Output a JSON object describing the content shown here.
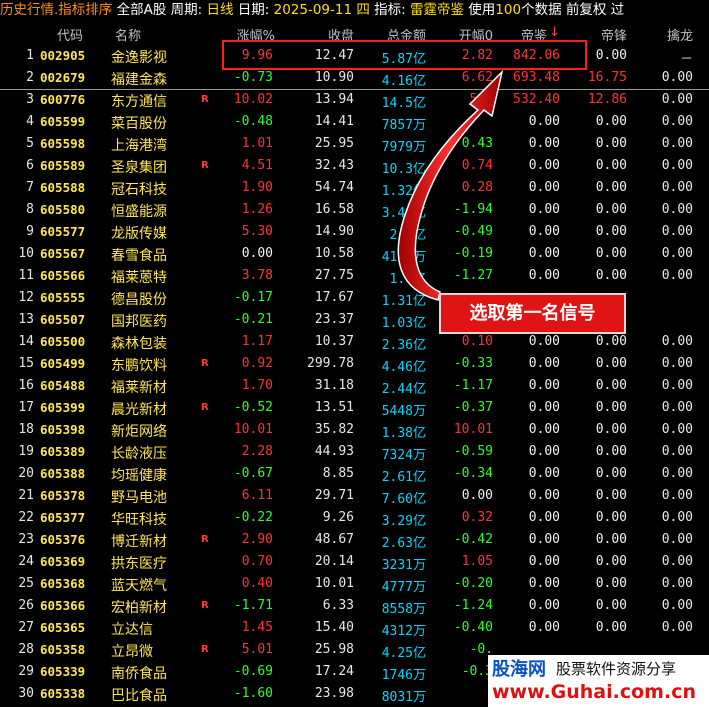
{
  "titlebar": {
    "segments": [
      {
        "text": "历史行情.指标排序 ",
        "color": "orange"
      },
      {
        "text": "全部A股 ",
        "color": "white"
      },
      {
        "text": "周期: ",
        "color": "white"
      },
      {
        "text": "日线 ",
        "color": "yellow"
      },
      {
        "text": "日期: ",
        "color": "white"
      },
      {
        "text": "2025-09-11 四 ",
        "color": "yellow"
      },
      {
        "text": "指标: ",
        "color": "white"
      },
      {
        "text": "雷霆帝鉴 ",
        "color": "yellow"
      },
      {
        "text": "使用",
        "color": "white"
      },
      {
        "text": "100",
        "color": "yellow"
      },
      {
        "text": "个数据 前复权 过",
        "color": "white"
      }
    ]
  },
  "columns": {
    "code": "代码",
    "name": "名称",
    "change": "涨幅%",
    "close": "收盘",
    "amount": "总金额",
    "open": "开幅0",
    "dijian": "帝鉴",
    "sort_arrow": "↓",
    "difeng": "帝锋",
    "qinlong": "擒龙"
  },
  "colors": {
    "up": "#ff3232",
    "down": "#2bff2b",
    "flat": "#f0f0f0",
    "highlight_box": "#ff1e1e",
    "callout_bg": "#e01414"
  },
  "rows": [
    {
      "idx": "1",
      "code": "002905",
      "name": "金逸影视",
      "flag": "",
      "chg": "9.96",
      "chg_dir": "up",
      "close": "12.47",
      "amt": "5.87亿",
      "open": "2.82",
      "open_dir": "up",
      "dj": "842.06",
      "dj_dir": "up",
      "df": "0.00",
      "df_dir": "flat",
      "ql": "－"
    },
    {
      "idx": "2",
      "code": "002679",
      "name": "福建金森",
      "flag": "",
      "chg": "-0.73",
      "chg_dir": "down",
      "close": "10.90",
      "amt": "4.16亿",
      "open": "6.62",
      "open_dir": "up",
      "dj": "693.48",
      "dj_dir": "up",
      "df": "16.75",
      "df_dir": "up",
      "ql": "0.00"
    },
    {
      "idx": "3",
      "code": "600776",
      "name": "东方通信",
      "flag": "R",
      "chg": "10.02",
      "chg_dir": "up",
      "close": "13.94",
      "amt": "14.5亿",
      "open": "5.7",
      "open_dir": "up",
      "dj": "532.40",
      "dj_dir": "up",
      "df": "12.86",
      "df_dir": "up",
      "ql": "0.00"
    },
    {
      "idx": "4",
      "code": "605599",
      "name": "菜百股份",
      "flag": "",
      "chg": "-0.48",
      "chg_dir": "down",
      "close": "14.41",
      "amt": "7857万",
      "open": "",
      "open_dir": "up",
      "dj": "0.00",
      "dj_dir": "flat",
      "df": "0.00",
      "df_dir": "flat",
      "ql": "0.00"
    },
    {
      "idx": "5",
      "code": "605598",
      "name": "上海港湾",
      "flag": "",
      "chg": "1.01",
      "chg_dir": "up",
      "close": "25.95",
      "amt": "7979万",
      "open": "0.43",
      "open_dir": "down",
      "dj": "0.00",
      "dj_dir": "flat",
      "df": "0.00",
      "df_dir": "flat",
      "ql": "0.00"
    },
    {
      "idx": "6",
      "code": "605589",
      "name": "圣泉集团",
      "flag": "R",
      "chg": "4.51",
      "chg_dir": "up",
      "close": "32.43",
      "amt": "10.3亿",
      "open": "0.74",
      "open_dir": "up",
      "dj": "0.00",
      "dj_dir": "flat",
      "df": "0.00",
      "df_dir": "flat",
      "ql": "0.00"
    },
    {
      "idx": "7",
      "code": "605588",
      "name": "冠石科技",
      "flag": "",
      "chg": "1.90",
      "chg_dir": "up",
      "close": "54.74",
      "amt": "1.32亿",
      "open": "0.28",
      "open_dir": "up",
      "dj": "0.00",
      "dj_dir": "flat",
      "df": "0.00",
      "df_dir": "flat",
      "ql": "0.00"
    },
    {
      "idx": "8",
      "code": "605580",
      "name": "恒盛能源",
      "flag": "",
      "chg": "1.26",
      "chg_dir": "up",
      "close": "16.58",
      "amt": "3.40亿",
      "open": "-1.94",
      "open_dir": "down",
      "dj": "0.00",
      "dj_dir": "flat",
      "df": "0.00",
      "df_dir": "flat",
      "ql": "0.00"
    },
    {
      "idx": "9",
      "code": "605577",
      "name": "龙版传媒",
      "flag": "",
      "chg": "5.30",
      "chg_dir": "up",
      "close": "14.90",
      "amt": "2.4亿",
      "open": "-0.49",
      "open_dir": "down",
      "dj": "0.00",
      "dj_dir": "flat",
      "df": "0.00",
      "df_dir": "flat",
      "ql": "0.00"
    },
    {
      "idx": "10",
      "code": "605567",
      "name": "春雪食品",
      "flag": "",
      "chg": "0.00",
      "chg_dir": "flat",
      "close": "10.58",
      "amt": "4175万",
      "open": "-0.19",
      "open_dir": "down",
      "dj": "0.00",
      "dj_dir": "flat",
      "df": "0.00",
      "df_dir": "flat",
      "ql": "0.00"
    },
    {
      "idx": "11",
      "code": "605566",
      "name": "福莱蒽特",
      "flag": "",
      "chg": "3.78",
      "chg_dir": "up",
      "close": "27.75",
      "amt": "1.0亿",
      "open": "-1.27",
      "open_dir": "down",
      "dj": "0.00",
      "dj_dir": "flat",
      "df": "0.00",
      "df_dir": "flat",
      "ql": "0.00"
    },
    {
      "idx": "12",
      "code": "605555",
      "name": "德昌股份",
      "flag": "",
      "chg": "-0.17",
      "chg_dir": "down",
      "close": "17.67",
      "amt": "1.31亿",
      "open": "",
      "open_dir": "flat",
      "dj": "",
      "dj_dir": "flat",
      "df": "",
      "df_dir": "flat",
      "ql": ""
    },
    {
      "idx": "13",
      "code": "605507",
      "name": "国邦医药",
      "flag": "",
      "chg": "-0.21",
      "chg_dir": "down",
      "close": "23.37",
      "amt": "1.03亿",
      "open": "",
      "open_dir": "flat",
      "dj": "",
      "dj_dir": "flat",
      "df": "",
      "df_dir": "flat",
      "ql": ""
    },
    {
      "idx": "14",
      "code": "605500",
      "name": "森林包装",
      "flag": "",
      "chg": "1.17",
      "chg_dir": "up",
      "close": "10.37",
      "amt": "2.36亿",
      "open": "0.10",
      "open_dir": "up",
      "dj": "0.00",
      "dj_dir": "flat",
      "df": "0.00",
      "df_dir": "flat",
      "ql": "0.00"
    },
    {
      "idx": "15",
      "code": "605499",
      "name": "东鹏饮料",
      "flag": "R",
      "chg": "0.92",
      "chg_dir": "up",
      "close": "299.78",
      "amt": "4.46亿",
      "open": "-0.33",
      "open_dir": "down",
      "dj": "0.00",
      "dj_dir": "flat",
      "df": "0.00",
      "df_dir": "flat",
      "ql": "0.00"
    },
    {
      "idx": "16",
      "code": "605488",
      "name": "福莱新材",
      "flag": "",
      "chg": "1.70",
      "chg_dir": "up",
      "close": "31.18",
      "amt": "2.44亿",
      "open": "-1.17",
      "open_dir": "down",
      "dj": "0.00",
      "dj_dir": "flat",
      "df": "0.00",
      "df_dir": "flat",
      "ql": "0.00"
    },
    {
      "idx": "17",
      "code": "605399",
      "name": "晨光新材",
      "flag": "R",
      "chg": "-0.52",
      "chg_dir": "down",
      "close": "13.51",
      "amt": "5448万",
      "open": "-0.37",
      "open_dir": "down",
      "dj": "0.00",
      "dj_dir": "flat",
      "df": "0.00",
      "df_dir": "flat",
      "ql": "0.00"
    },
    {
      "idx": "18",
      "code": "605398",
      "name": "新炬网络",
      "flag": "",
      "chg": "10.01",
      "chg_dir": "up",
      "close": "35.82",
      "amt": "1.38亿",
      "open": "10.01",
      "open_dir": "up",
      "dj": "0.00",
      "dj_dir": "flat",
      "df": "0.00",
      "df_dir": "flat",
      "ql": "0.00"
    },
    {
      "idx": "19",
      "code": "605389",
      "name": "长龄液压",
      "flag": "",
      "chg": "2.28",
      "chg_dir": "up",
      "close": "44.93",
      "amt": "7324万",
      "open": "-0.59",
      "open_dir": "down",
      "dj": "0.00",
      "dj_dir": "flat",
      "df": "0.00",
      "df_dir": "flat",
      "ql": "0.00"
    },
    {
      "idx": "20",
      "code": "605388",
      "name": "均瑶健康",
      "flag": "",
      "chg": "-0.67",
      "chg_dir": "down",
      "close": "8.85",
      "amt": "2.61亿",
      "open": "-0.34",
      "open_dir": "down",
      "dj": "0.00",
      "dj_dir": "flat",
      "df": "0.00",
      "df_dir": "flat",
      "ql": "0.00"
    },
    {
      "idx": "21",
      "code": "605378",
      "name": "野马电池",
      "flag": "",
      "chg": "6.11",
      "chg_dir": "up",
      "close": "29.71",
      "amt": "7.60亿",
      "open": "0.00",
      "open_dir": "flat",
      "dj": "0.00",
      "dj_dir": "flat",
      "df": "0.00",
      "df_dir": "flat",
      "ql": "0.00"
    },
    {
      "idx": "22",
      "code": "605377",
      "name": "华旺科技",
      "flag": "",
      "chg": "-0.22",
      "chg_dir": "down",
      "close": "9.26",
      "amt": "3.29亿",
      "open": "0.32",
      "open_dir": "up",
      "dj": "0.00",
      "dj_dir": "flat",
      "df": "0.00",
      "df_dir": "flat",
      "ql": "0.00"
    },
    {
      "idx": "23",
      "code": "605376",
      "name": "博迁新材",
      "flag": "R",
      "chg": "2.90",
      "chg_dir": "up",
      "close": "48.67",
      "amt": "2.63亿",
      "open": "-0.42",
      "open_dir": "down",
      "dj": "0.00",
      "dj_dir": "flat",
      "df": "0.00",
      "df_dir": "flat",
      "ql": "0.00"
    },
    {
      "idx": "24",
      "code": "605369",
      "name": "拱东医疗",
      "flag": "",
      "chg": "0.70",
      "chg_dir": "up",
      "close": "20.14",
      "amt": "3231万",
      "open": "1.05",
      "open_dir": "up",
      "dj": "0.00",
      "dj_dir": "flat",
      "df": "0.00",
      "df_dir": "flat",
      "ql": "0.00"
    },
    {
      "idx": "25",
      "code": "605368",
      "name": "蓝天燃气",
      "flag": "",
      "chg": "0.40",
      "chg_dir": "up",
      "close": "10.01",
      "amt": "4777万",
      "open": "-0.20",
      "open_dir": "down",
      "dj": "0.00",
      "dj_dir": "flat",
      "df": "0.00",
      "df_dir": "flat",
      "ql": "0.00"
    },
    {
      "idx": "26",
      "code": "605366",
      "name": "宏柏新材",
      "flag": "R",
      "chg": "-1.71",
      "chg_dir": "down",
      "close": "6.33",
      "amt": "8558万",
      "open": "-1.24",
      "open_dir": "down",
      "dj": "0.00",
      "dj_dir": "flat",
      "df": "0.00",
      "df_dir": "flat",
      "ql": "0.00"
    },
    {
      "idx": "27",
      "code": "605365",
      "name": "立达信",
      "flag": "",
      "chg": "1.45",
      "chg_dir": "up",
      "close": "15.40",
      "amt": "4312万",
      "open": "-0.40",
      "open_dir": "down",
      "dj": "0.00",
      "dj_dir": "flat",
      "df": "0.00",
      "df_dir": "flat",
      "ql": "0.00"
    },
    {
      "idx": "28",
      "code": "605358",
      "name": "立昂微",
      "flag": "R",
      "chg": "5.01",
      "chg_dir": "up",
      "close": "25.98",
      "amt": "4.25亿",
      "open": "-0.",
      "open_dir": "down",
      "dj": "",
      "dj_dir": "flat",
      "df": "",
      "df_dir": "flat",
      "ql": ""
    },
    {
      "idx": "29",
      "code": "605339",
      "name": "南侨食品",
      "flag": "",
      "chg": "-0.69",
      "chg_dir": "down",
      "close": "17.24",
      "amt": "1746万",
      "open": "-0.3",
      "open_dir": "down",
      "dj": "",
      "dj_dir": "flat",
      "df": "",
      "df_dir": "flat",
      "ql": ""
    },
    {
      "idx": "30",
      "code": "605338",
      "name": "巴比食品",
      "flag": "",
      "chg": "-1.60",
      "chg_dir": "down",
      "close": "23.98",
      "amt": "8031万",
      "open": "",
      "open_dir": "flat",
      "dj": "",
      "dj_dir": "flat",
      "df": "",
      "df_dir": "flat",
      "ql": ""
    }
  ],
  "callout": {
    "text": "选取第一名信号"
  },
  "watermark": {
    "title": "股海网",
    "subtitle": "股票软件资源分享",
    "url": "www.Guhai.com.cn"
  }
}
